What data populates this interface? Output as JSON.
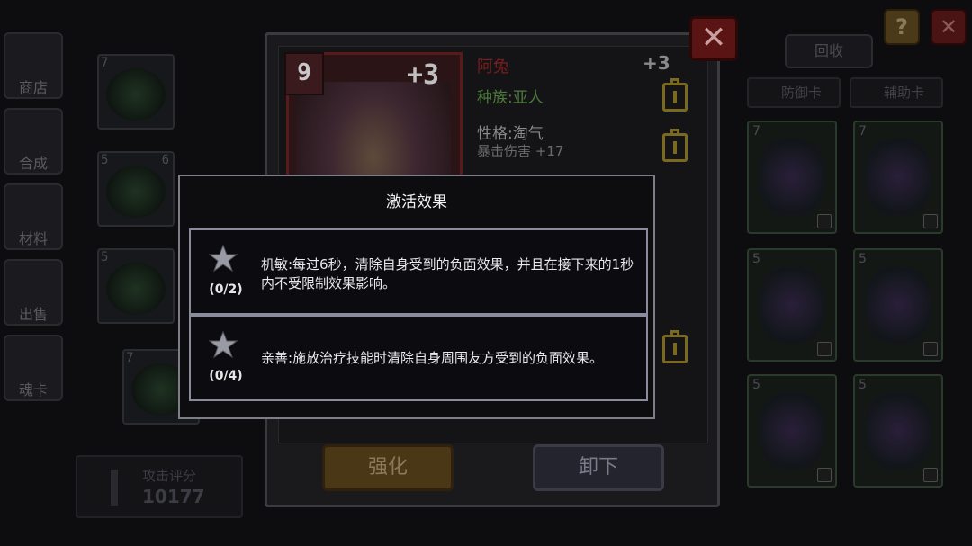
{
  "background": {
    "side_tabs": [
      {
        "label": "商店"
      },
      {
        "label": "合成"
      },
      {
        "label": "材料"
      },
      {
        "label": "出售"
      },
      {
        "label": "魂卡"
      }
    ],
    "left_cards": [
      {
        "level": "7"
      },
      {
        "level": "5",
        "badge": "6"
      },
      {
        "level": "5"
      },
      {
        "level": "7"
      }
    ],
    "right_cards": [
      {
        "level": "7"
      },
      {
        "level": "7"
      },
      {
        "level": "5"
      },
      {
        "level": "5"
      },
      {
        "level": "5"
      },
      {
        "level": "5"
      }
    ],
    "recycle_label": "回收",
    "filter_tabs": [
      "防御卡",
      "辅助卡"
    ],
    "score_label": "攻击评分",
    "score_value": "10177",
    "help_label": "?",
    "top_close_label": "✕"
  },
  "detail": {
    "level": "9",
    "plus_badge": "+3",
    "name": "阿兔",
    "plus_top": "+3",
    "race": "种族:亚人",
    "trait": "性格:淘气",
    "trait_value": "暴击伤害 +17",
    "close_label": "✕",
    "strengthen_label": "强化",
    "unequip_label": "卸下"
  },
  "modal": {
    "title": "激活效果",
    "effects": [
      {
        "count": "(0/2)",
        "text": "机敏:每过6秒，清除自身受到的负面效果，并且在接下来的1秒内不受限制效果影响。"
      },
      {
        "count": "(0/4)",
        "text": "亲善:施放治疗技能时清除自身周围友方受到的负面效果。"
      }
    ]
  }
}
